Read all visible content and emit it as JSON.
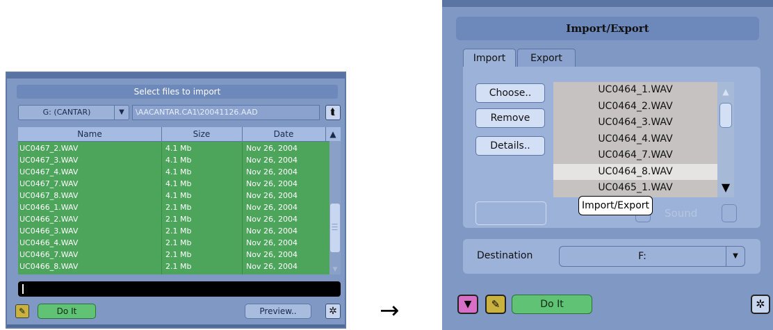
{
  "left_dialog": {
    "title": "Select files to import",
    "drive": "G: (CANTAR)",
    "path": "\\AACANTAR.CA1\\20041126.AAD",
    "columns": [
      "Name",
      "Size",
      "Date"
    ],
    "files": [
      {
        "name": "UC0467_2.WAV",
        "size": "4.1 Mb",
        "date": "Nov 26, 2004"
      },
      {
        "name": "UC0467_3.WAV",
        "size": "4.1 Mb",
        "date": "Nov 26, 2004"
      },
      {
        "name": "UC0467_4.WAV",
        "size": "4.1 Mb",
        "date": "Nov 26, 2004"
      },
      {
        "name": "UC0467_7.WAV",
        "size": "4.1 Mb",
        "date": "Nov 26, 2004"
      },
      {
        "name": "UC0467_8.WAV",
        "size": "4.1 Mb",
        "date": "Nov 26, 2004"
      },
      {
        "name": "UC0466_1.WAV",
        "size": "2.1 Mb",
        "date": "Nov 26, 2004"
      },
      {
        "name": "UC0466_2.WAV",
        "size": "2.1 Mb",
        "date": "Nov 26, 2004"
      },
      {
        "name": "UC0466_3.WAV",
        "size": "2.1 Mb",
        "date": "Nov 26, 2004"
      },
      {
        "name": "UC0466_4.WAV",
        "size": "2.1 Mb",
        "date": "Nov 26, 2004"
      },
      {
        "name": "UC0466_7.WAV",
        "size": "2.1 Mb",
        "date": "Nov 26, 2004"
      },
      {
        "name": "UC0466_8.WAV",
        "size": "2.1 Mb",
        "date": "Nov 26, 2004"
      }
    ],
    "do_it": "Do It",
    "preview": "Preview.."
  },
  "right_dialog": {
    "title": "Import/Export",
    "tabs": [
      "Import",
      "Export"
    ],
    "buttons": [
      "Choose..",
      "Remove",
      "Details.."
    ],
    "files": [
      "UC0464_1.WAV",
      "UC0464_2.WAV",
      "UC0464_3.WAV",
      "UC0464_4.WAV",
      "UC0464_7.WAV",
      "UC0464_8.WAV",
      "UC0465_1.WAV"
    ],
    "selected_file": "UC0464_8.WAV",
    "tooltip": "Import/Export",
    "ghost_label_1": "...",
    "ghost_label_2": "Sound",
    "destination_label": "Destination",
    "destination_value": "F:",
    "do_it": "Do It"
  }
}
